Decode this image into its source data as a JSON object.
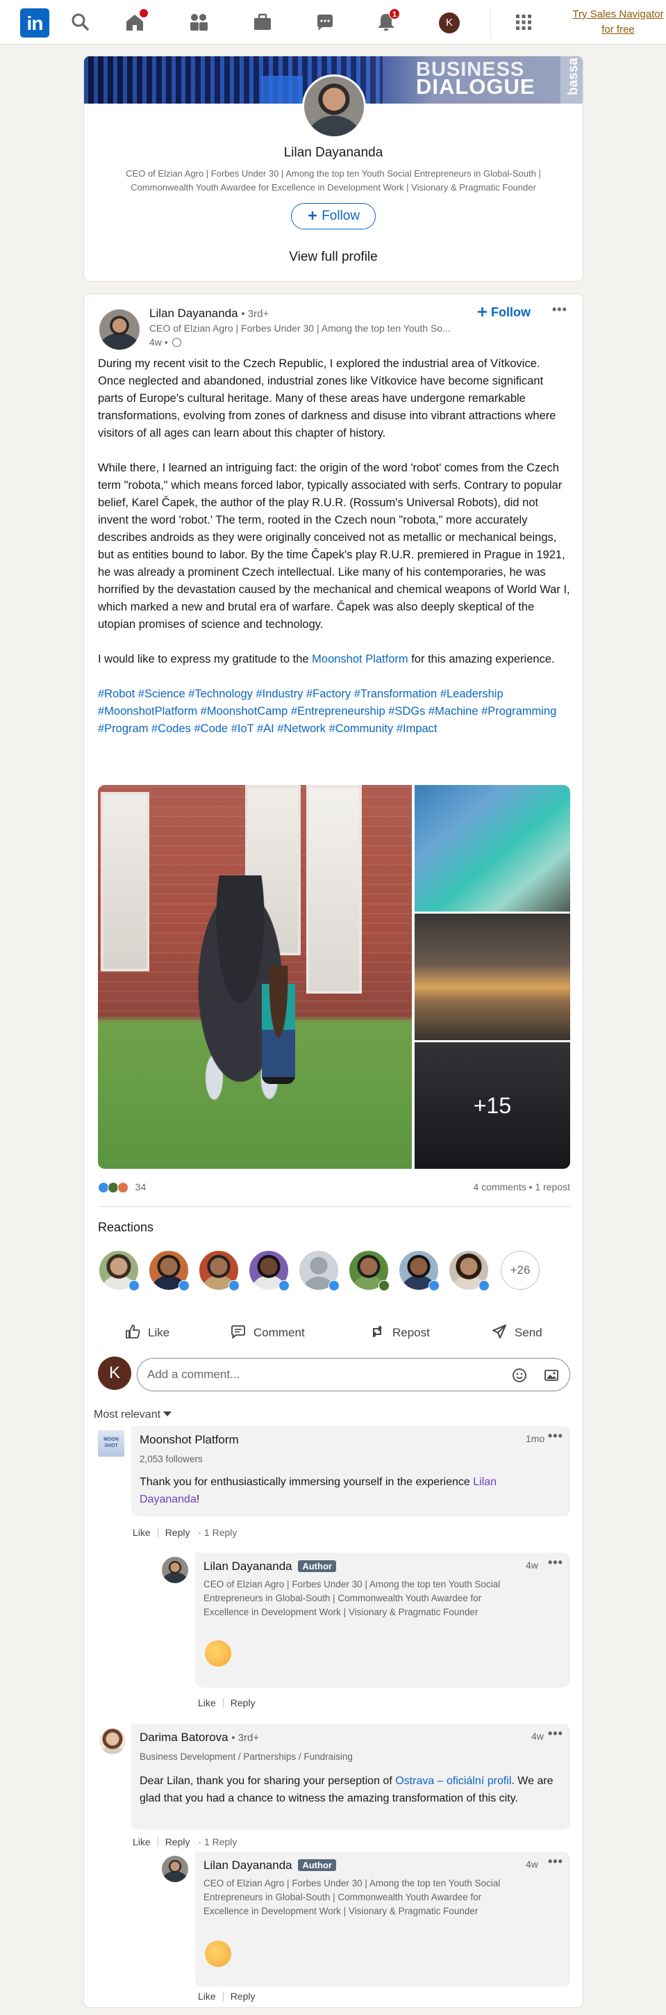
{
  "nav": {
    "logo": "in",
    "home_badge": "",
    "notifications_badge": "1",
    "me_initial": "K",
    "sales_navigator_line1": "Try Sales Navigator",
    "sales_navigator_line2": "for free"
  },
  "profile_card": {
    "banner_line1": "BUSINESS",
    "banner_line2": "DIALOGUE",
    "banner_side": "bassa",
    "name": "Lilan Dayananda",
    "headline_line1": "CEO of Elzian Agro | Forbes Under 30 | Among the top ten Youth Social Entrepreneurs in Global-South |",
    "headline_line2": "Commonwealth Youth Awardee for Excellence in Development Work | Visionary & Pragmatic Founder",
    "follow_label": "Follow",
    "view_profile_label": "View full profile"
  },
  "post": {
    "author": "Lilan Dayananda",
    "degree": "• 3rd+",
    "headline": "CEO of Elzian Agro | Forbes Under 30 | Among the top ten Youth So...",
    "time": "4w •",
    "follow_label": "Follow",
    "para1": "During my recent visit to the Czech Republic, I explored the industrial area of Vítkovice. Once neglected and abandoned, industrial zones like Vítkovice have become significant parts of Europe's cultural heritage. Many of these areas have undergone remarkable transformations, evolving from zones of darkness and disuse into vibrant attractions where visitors of all ages can learn about this chapter of history.",
    "para2": "While there, I learned an intriguing fact: the origin of the word 'robot' comes from the Czech term \"robota,\" which means forced labor, typically associated with serfs. Contrary to popular belief, Karel Čapek, the author of the play R.U.R. (Rossum's Universal Robots), did not invent the word 'robot.' The term, rooted in the Czech noun \"robota,\" more accurately describes androids as they were originally conceived not as metallic or mechanical beings, but as entities bound to labor. By the time Čapek's play R.U.R. premiered in Prague in 1921, he was already a prominent Czech intellectual. Like many of his contemporaries, he was horrified by the devastation caused by the mechanical and chemical weapons of World War I, which marked a new and brutal era of warfare. Čapek was also deeply skeptical of the utopian promises of science and technology.",
    "para3_before": "I would like to express my gratitude to the ",
    "para3_link": "Moonshot Platform",
    "para3_after": " for this amazing experience.",
    "hashtags": "#Robot #Science #Technology #Industry #Factory #Transformation #Leadership #MoonshotPlatform #MoonshotCamp #Entrepreneurship #SDGs #Machine #Programming #Program #Codes #Code #IoT #AI #Network #Community #Impact",
    "more_photos": "+15",
    "reaction_count": "34",
    "comments_reposts": "4 comments • 1 repost",
    "reactions_title": "Reactions",
    "more_reactors": "+26",
    "actions": {
      "like": "Like",
      "comment": "Comment",
      "repost": "Repost",
      "send": "Send"
    },
    "comment_avatar_initial": "K",
    "comment_placeholder": "Add a comment...",
    "sort_label": "Most relevant"
  },
  "comments": [
    {
      "name": "Moonshot Platform",
      "sub": "2,053 followers",
      "time": "1mo",
      "text_before": "Thank you for enthusiastically immersing yourself in the experience ",
      "mention": "Lilan Dayananda",
      "text_after": "!",
      "like": "Like",
      "reply": "Reply",
      "replies": "· 1 Reply",
      "logo_text": "MOON SHOT"
    },
    {
      "name": "Lilan Dayananda",
      "author_tag": "Author",
      "sub_line1": "CEO of Elzian Agro | Forbes Under 30 | Among the top ten Youth Social",
      "sub_line2": "Entrepreneurs in Global-South | Commonwealth Youth Awardee for",
      "sub_line3": "Excellence in Development Work | Visionary & Pragmatic Founder",
      "time": "4w",
      "like": "Like",
      "reply": "Reply"
    },
    {
      "name": "Darima Batorova",
      "degree": "• 3rd+",
      "sub": "Business Development / Partnerships / Fundraising",
      "time": "4w",
      "text_before": "Dear Lilan, thank you for sharing your perseption of ",
      "link": "Ostrava – oficiální profil",
      "text_after": ". We are glad that you had a chance to witness the amazing transformation of this city.",
      "like": "Like",
      "reply": "Reply",
      "replies": "· 1 Reply"
    },
    {
      "name": "Lilan Dayananda",
      "author_tag": "Author",
      "sub_line1": "CEO of Elzian Agro | Forbes Under 30 | Among the top ten Youth Social",
      "sub_line2": "Entrepreneurs in Global-South | Commonwealth Youth Awardee for",
      "sub_line3": "Excellence in Development Work | Visionary & Pragmatic Founder",
      "time": "4w",
      "like": "Like",
      "reply": "Reply"
    }
  ],
  "colors": {
    "brand": "#0a66c2",
    "badge": "#cc1016",
    "mention": "#6e3fbf",
    "sales_link": "#915907"
  },
  "icons": [
    "home-icon",
    "search-icon",
    "network-icon",
    "jobs-icon",
    "messaging-icon",
    "notifications-icon",
    "apps-grid-icon",
    "globe-icon",
    "like-icon",
    "comment-icon",
    "repost-icon",
    "send-icon",
    "emoji-icon",
    "image-icon",
    "more-icon"
  ]
}
